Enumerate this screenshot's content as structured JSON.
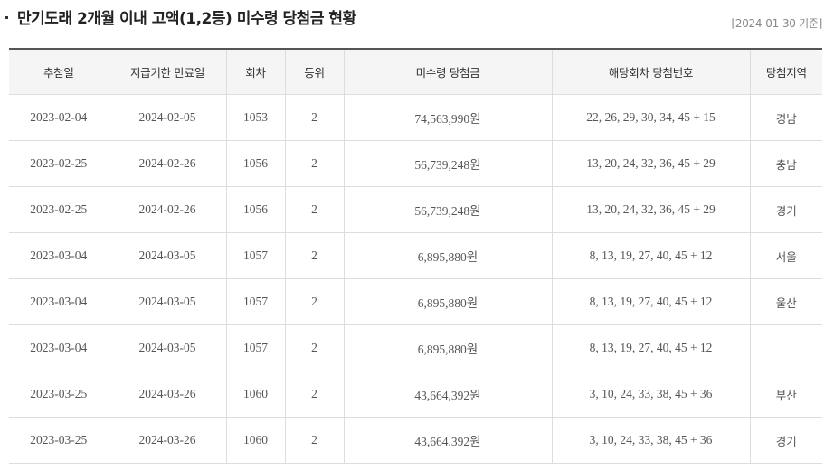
{
  "header": {
    "title": "만기도래 2개월 이내 고액(1,2등) 미수령 당첨금 현황",
    "as_of": "[2024-01-30 기준]"
  },
  "table": {
    "columns": [
      "추첨일",
      "지급기한 만료일",
      "회차",
      "등위",
      "미수령 당첨금",
      "해당회차 당첨번호",
      "당첨지역"
    ],
    "rows": [
      {
        "draw_date": "2023-02-04",
        "deadline": "2024-02-05",
        "round": "1053",
        "rank": "2",
        "amount": "74,563,990원",
        "numbers": "22, 26, 29, 30, 34, 45 + 15",
        "region": "경남"
      },
      {
        "draw_date": "2023-02-25",
        "deadline": "2024-02-26",
        "round": "1056",
        "rank": "2",
        "amount": "56,739,248원",
        "numbers": "13, 20, 24, 32, 36, 45 + 29",
        "region": "충남"
      },
      {
        "draw_date": "2023-02-25",
        "deadline": "2024-02-26",
        "round": "1056",
        "rank": "2",
        "amount": "56,739,248원",
        "numbers": "13, 20, 24, 32, 36, 45 + 29",
        "region": "경기"
      },
      {
        "draw_date": "2023-03-04",
        "deadline": "2024-03-05",
        "round": "1057",
        "rank": "2",
        "amount": "6,895,880원",
        "numbers": "8, 13, 19, 27, 40, 45 + 12",
        "region": "서울"
      },
      {
        "draw_date": "2023-03-04",
        "deadline": "2024-03-05",
        "round": "1057",
        "rank": "2",
        "amount": "6,895,880원",
        "numbers": "8, 13, 19, 27, 40, 45 + 12",
        "region": "울산"
      },
      {
        "draw_date": "2023-03-04",
        "deadline": "2024-03-05",
        "round": "1057",
        "rank": "2",
        "amount": "6,895,880원",
        "numbers": "8, 13, 19, 27, 40, 45 + 12",
        "region": ""
      },
      {
        "draw_date": "2023-03-25",
        "deadline": "2024-03-26",
        "round": "1060",
        "rank": "2",
        "amount": "43,664,392원",
        "numbers": "3, 10, 24, 33, 38, 45 + 36",
        "region": "부산"
      },
      {
        "draw_date": "2023-03-25",
        "deadline": "2024-03-26",
        "round": "1060",
        "rank": "2",
        "amount": "43,664,392원",
        "numbers": "3, 10, 24, 33, 38, 45 + 36",
        "region": "경기"
      }
    ]
  }
}
